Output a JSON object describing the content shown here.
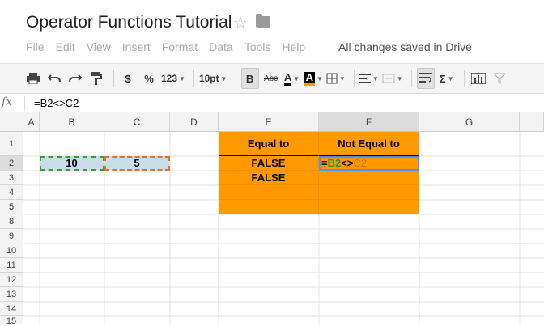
{
  "app": {
    "title": "Operator Functions Tutorial",
    "saved_status": "All changes saved in Drive",
    "menu": [
      "File",
      "Edit",
      "View",
      "Insert",
      "Format",
      "Data",
      "Tools",
      "Help"
    ]
  },
  "toolbar": {
    "currency": "$",
    "percent": "%",
    "number_format": "123",
    "font_size": "10pt",
    "bold": "B",
    "strike": "Abc",
    "text_color": "A",
    "fill_color": "A",
    "sum": "Σ"
  },
  "formula_bar": {
    "fx": "fx",
    "content": "=B2<>C2"
  },
  "columns": [
    "A",
    "B",
    "C",
    "D",
    "E",
    "F",
    "G"
  ],
  "rows": [
    "1",
    "2",
    "3",
    "4",
    "5",
    "8",
    "9",
    "10",
    "11",
    "12",
    "13",
    "14",
    "15"
  ],
  "cells": {
    "E1": "Equal to",
    "F1": "Not Equal to",
    "B2": "10",
    "C2": "5",
    "E2": "FALSE",
    "E3": "FALSE",
    "F2_parts": [
      "=",
      "B2",
      "<>",
      "C2"
    ]
  },
  "colors": {
    "header_fill": "#ff9900",
    "selected_fill": "#c9dde8",
    "active_border": "#4d90fe"
  }
}
